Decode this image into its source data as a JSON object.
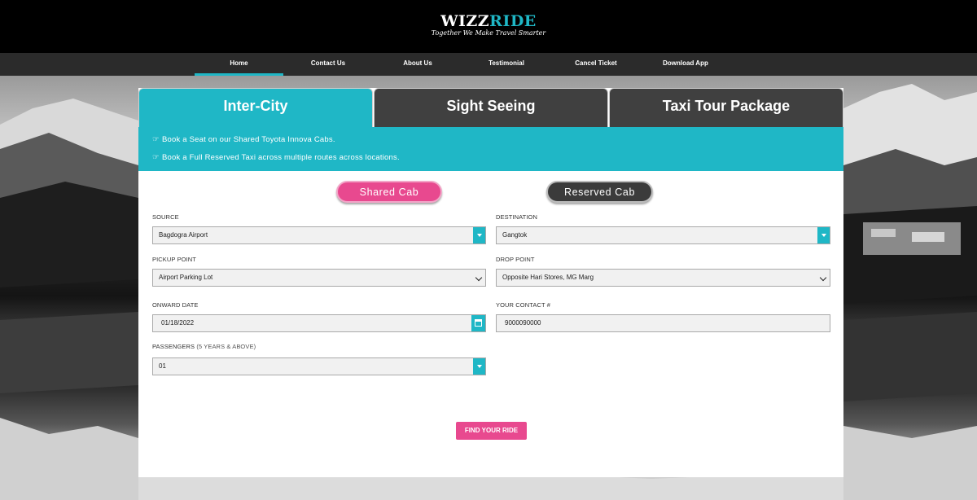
{
  "brand": {
    "logo_part1": "WIZZ",
    "logo_part2": "RIDE",
    "tagline": "Together We Make Travel Smarter",
    "accent_color": "#1fb7c6",
    "pink_color": "#e8498f"
  },
  "nav": {
    "items": [
      {
        "label": "Home",
        "active": true
      },
      {
        "label": "Contact Us"
      },
      {
        "label": "About Us"
      },
      {
        "label": "Testimonial"
      },
      {
        "label": "Cancel Ticket"
      },
      {
        "label": "Download App"
      }
    ]
  },
  "tabs": [
    {
      "label": "Inter-City",
      "active": true
    },
    {
      "label": "Sight Seeing"
    },
    {
      "label": "Taxi Tour Package"
    }
  ],
  "info": {
    "icon": "thumbs-up-icon",
    "lines": [
      "Book a Seat on our Shared Toyota Innova Cabs.",
      "Book a Full Reserved Taxi across multiple routes across locations."
    ]
  },
  "cab_type": {
    "shared_label": "Shared Cab",
    "reserved_label": "Reserved Cab"
  },
  "form": {
    "source": {
      "label": "SOURCE",
      "value": "Bagdogra Airport"
    },
    "destination": {
      "label": "DESTINATION",
      "value": "Gangtok"
    },
    "pickup": {
      "label": "PICKUP POINT",
      "value": "Airport Parking Lot"
    },
    "drop": {
      "label": "DROP POINT",
      "value": "Opposite Hari Stores, MG Marg"
    },
    "onward_date": {
      "label": "ONWARD DATE",
      "value": "01/18/2022"
    },
    "contact": {
      "label": "YOUR CONTACT #",
      "value": "9000090000"
    },
    "passengers": {
      "label": "PASSENGERS",
      "sublabel": "(5 YEARS & ABOVE)",
      "value": "01"
    }
  },
  "actions": {
    "find_label": "FIND YOUR RIDE"
  }
}
